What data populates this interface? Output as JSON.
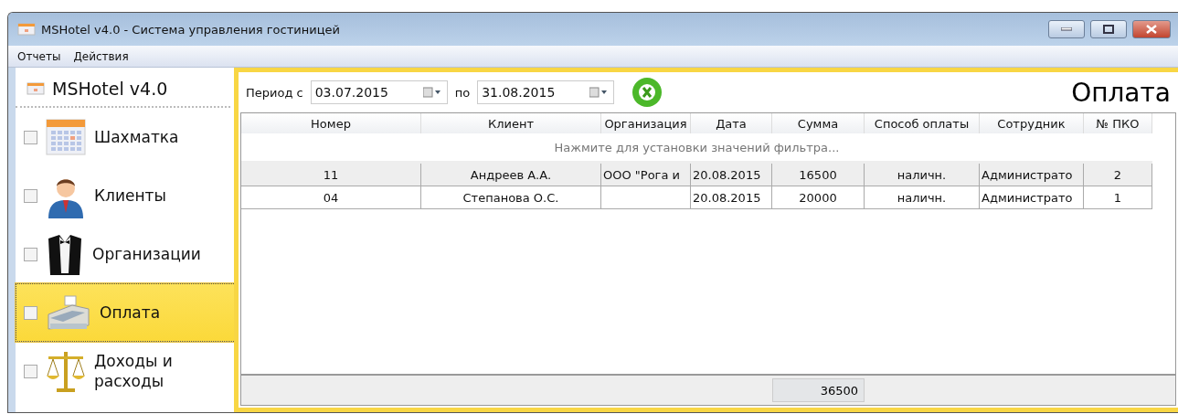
{
  "window": {
    "title": "MSHotel v4.0 - Система управления гостиницей"
  },
  "menu": [
    "Отчеты",
    "Действия"
  ],
  "sidebar": {
    "title": "MSHotel v4.0",
    "items": [
      {
        "kind": "calendar",
        "label": "Шахматка",
        "checked": false,
        "selected": false
      },
      {
        "kind": "person",
        "label": "Клиенты",
        "checked": false,
        "selected": false
      },
      {
        "kind": "tuxedo",
        "label": "Организации",
        "checked": false,
        "selected": false
      },
      {
        "kind": "register",
        "label": "Оплата",
        "checked": false,
        "selected": true
      },
      {
        "kind": "scales",
        "label": "Доходы и расходы",
        "checked": false,
        "selected": false
      }
    ]
  },
  "filter": {
    "period_label": "Период с",
    "from": "03.07.2015",
    "to_label": "по",
    "to": "31.08.2015"
  },
  "page_title": "Оплата",
  "table": {
    "columns": [
      "Номер",
      "Клиент",
      "Организация",
      "Дата",
      "Сумма",
      "Способ оплаты",
      "Сотрудник",
      "№ ПКО"
    ],
    "filter_hint": "Нажмите для установки значений фильтра...",
    "rows": [
      {
        "selected": true,
        "cells": [
          "11",
          "Андреев А.А.",
          "ООО \"Рога и",
          "20.08.2015",
          "16500",
          "наличн.",
          "Администрато",
          "2"
        ]
      },
      {
        "selected": false,
        "cells": [
          "04",
          "Степанова О.С.",
          "",
          "20.08.2015",
          "20000",
          "наличн.",
          "Администрато",
          "1"
        ]
      }
    ],
    "total": "36500"
  }
}
